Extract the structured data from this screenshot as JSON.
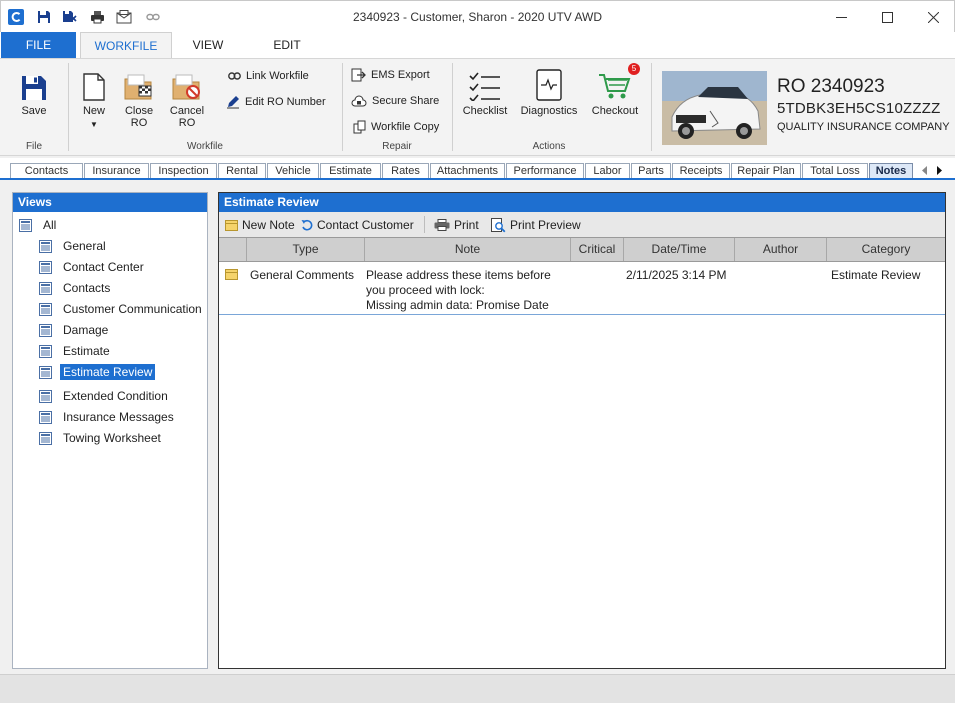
{
  "window": {
    "title": "2340923 - Customer, Sharon - 2020 UTV AWD"
  },
  "menu": {
    "file": "FILE",
    "workfile": "WORKFILE",
    "view": "VIEW",
    "edit": "EDIT"
  },
  "ribbon": {
    "file_group": {
      "label": "File",
      "save": "Save"
    },
    "workfile_group": {
      "label": "Workfile",
      "new": "New",
      "close_ro": [
        "Close",
        "RO"
      ],
      "cancel_ro": [
        "Cancel",
        "RO"
      ],
      "link_workfile": "Link Workfile",
      "edit_ro_number": "Edit RO Number"
    },
    "repair_group": {
      "label": "Repair",
      "ems_export": "EMS Export",
      "secure_share": "Secure Share",
      "workfile_copy": "Workfile Copy"
    },
    "actions_group": {
      "label": "Actions",
      "checklist": "Checklist",
      "diagnostics": "Diagnostics",
      "checkout": "Checkout",
      "checkout_badge": "5"
    },
    "ro_card": {
      "ro_number": "RO 2340923",
      "vin": "5TDBK3EH5CS10ZZZZ",
      "insurance": "QUALITY INSURANCE COMPANY"
    }
  },
  "tabs": [
    "Contacts",
    "Insurance",
    "Inspection",
    "Rental",
    "Vehicle",
    "Estimate",
    "Rates",
    "Attachments",
    "Performance",
    "Labor",
    "Parts",
    "Receipts",
    "Repair Plan",
    "Total Loss",
    "Notes"
  ],
  "active_tab": "Notes",
  "views": {
    "title": "Views",
    "root": "All",
    "items": [
      "General",
      "Contact Center",
      "Contacts",
      "Customer Communication",
      "Damage",
      "Estimate",
      "Estimate Review",
      "Extended Condition",
      "Insurance Messages",
      "Towing Worksheet"
    ],
    "selected": "Estimate Review"
  },
  "main": {
    "title": "Estimate Review",
    "toolbar": {
      "new_note": "New Note",
      "contact_customer": "Contact Customer",
      "print": "Print",
      "print_preview": "Print Preview"
    },
    "columns": [
      "Type",
      "Note",
      "Critical",
      "Date/Time",
      "Author",
      "Category"
    ],
    "rows": [
      {
        "type": "General Comments",
        "note_lines": [
          "Please address these items before",
          "you proceed with lock:",
          "Missing admin data: Promise Date"
        ],
        "critical": "",
        "datetime": "2/11/2025 3:14 PM",
        "author": "",
        "category": "Estimate Review"
      }
    ]
  },
  "colors": {
    "accent": "#1e6fd0",
    "checkout_badge": "#e02020",
    "checkout_cart": "#2e9a4a"
  }
}
